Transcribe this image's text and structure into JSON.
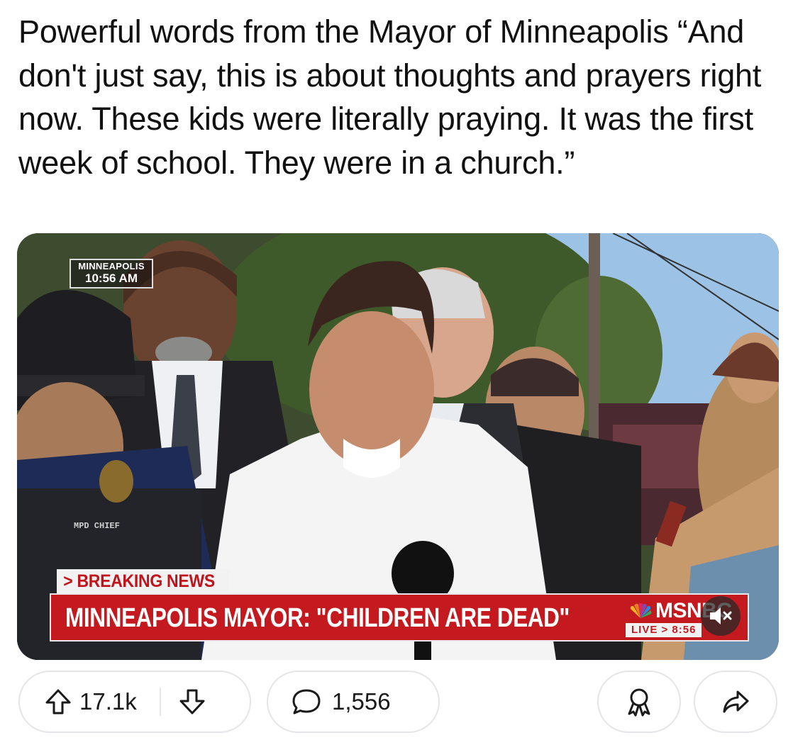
{
  "post": {
    "title": "Powerful words from the Mayor of Minneapolis “And don't just say, this is about thoughts and prayers right now. These kids were literally praying. It was the first week of school. They were in a church.”"
  },
  "video": {
    "location": "MINNEAPOLIS",
    "time": "10:56 AM",
    "badge_text": "MPD CHIEF",
    "breaking_label": "> BREAKING NEWS",
    "headline": "MINNEAPOLIS MAYOR: \"CHILDREN ARE DEAD\"",
    "network": "MSNBC",
    "live_label": "LIVE > 8:56",
    "muted": true
  },
  "actions": {
    "upvotes": "17.1k",
    "comments": "1,556",
    "icons": [
      "upvote-icon",
      "downvote-icon",
      "comment-icon",
      "award-icon",
      "share-icon",
      "mute-icon"
    ]
  },
  "colors": {
    "headline_bar": "#c41a1f",
    "breaking_text": "#c0141c",
    "pill_border": "#e3e5e8"
  }
}
